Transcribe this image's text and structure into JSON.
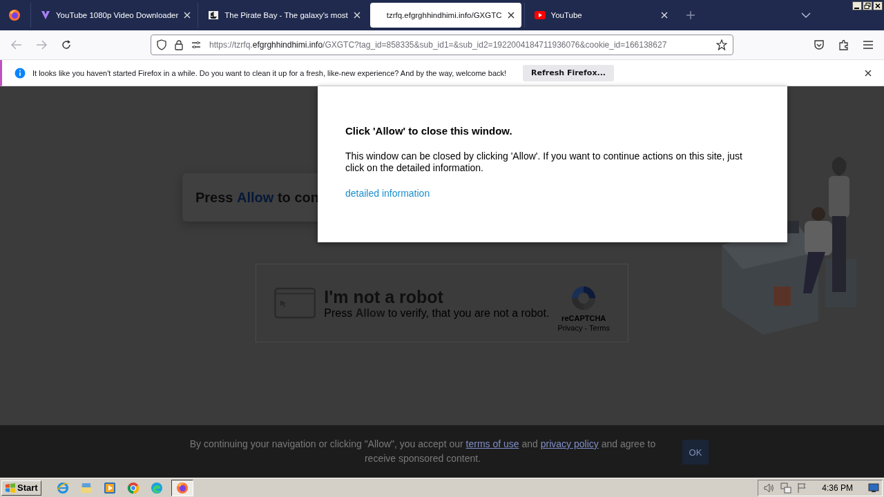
{
  "tabs": [
    {
      "title": "YouTube 1080p Video Downloader",
      "selected": false
    },
    {
      "title": "The Pirate Bay - The galaxy's most",
      "selected": false
    },
    {
      "title": "tzrfq.efgrghhindhimi.info/GXGTC",
      "selected": true
    },
    {
      "title": "YouTube",
      "selected": false
    }
  ],
  "address_bar": {
    "url": "https://tzrfq.**efgrghhindhimi.info**/GXGTC?tag_id=858335&sub_id1=&sub_id2=1922004184711936076&cookie_id=166138627"
  },
  "notification": {
    "message": "It looks like you haven't started Firefox in a while. Do you want to clean it up for a fresh, like-new experience? And by the way, welcome back!",
    "button": "Refresh Firefox..."
  },
  "page": {
    "prompt": "Press **Allow** to con",
    "captcha": {
      "title": "I'm not a robot",
      "subtitle": "Press **Allow** to verify, that you are not a robot.",
      "brand": "reCAPTCHA",
      "links": "Privacy - Terms"
    },
    "footer": {
      "text_before": "By continuing your navigation or clicking \"Allow\", you accept our",
      "terms_link": "terms of use",
      "text_middle": "and",
      "privacy_link": "privacy policy",
      "text_after": "and agree to receive sponsored content.",
      "button": "OK"
    }
  },
  "dialog": {
    "title": "Click 'Allow' to close this window.",
    "body": "This window can be closed by clicking 'Allow'. If you want to continue actions on this site, just click on the detailed information.",
    "link": "detailed information"
  },
  "taskbar": {
    "start": "Start",
    "apps": [
      {
        "kind": "ie",
        "selected": false
      },
      {
        "kind": "folder",
        "selected": false
      },
      {
        "kind": "media",
        "selected": false
      },
      {
        "kind": "chrome",
        "selected": false
      },
      {
        "kind": "edge",
        "selected": false
      },
      {
        "kind": "firefox",
        "selected": true
      }
    ],
    "clock": "4:36 PM"
  }
}
